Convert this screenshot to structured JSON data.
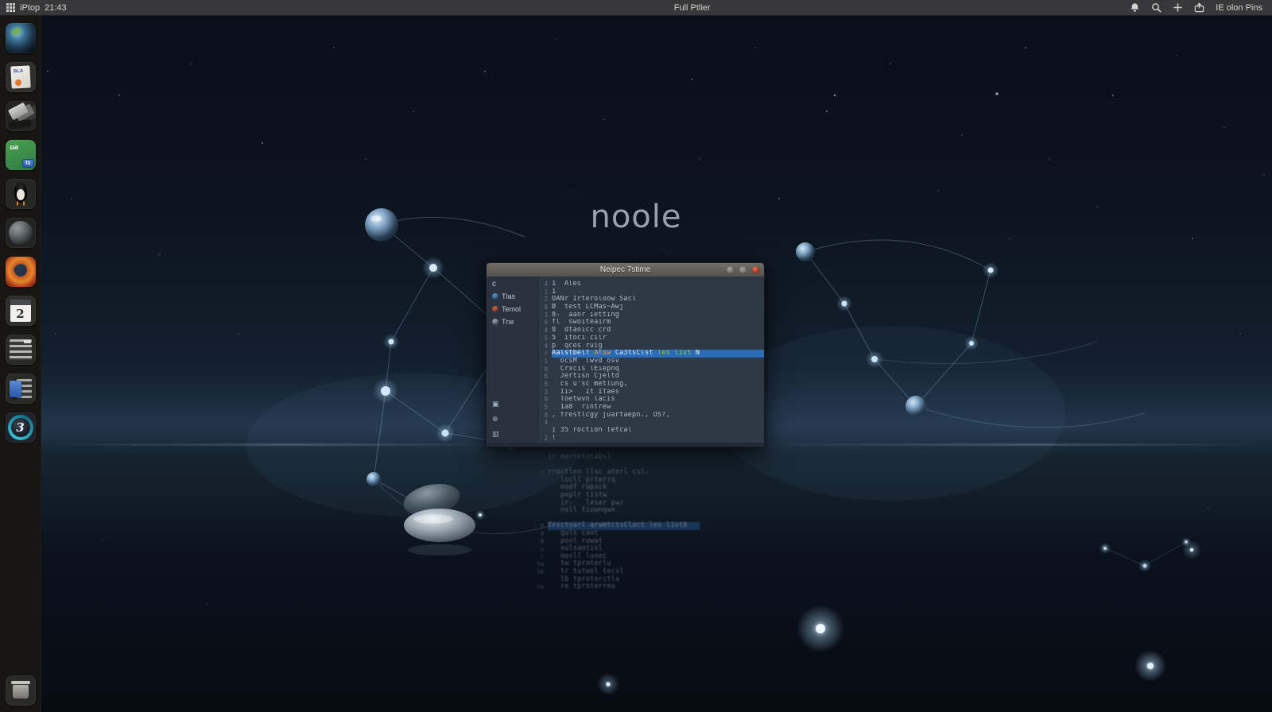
{
  "topbar": {
    "left_app": "iPtop",
    "left_time": "21:43",
    "center": "Full Ptlier",
    "right_label": "IE olon Pins",
    "right_icons": [
      "bell-icon",
      "search-icon",
      "plus-icon",
      "share-icon"
    ]
  },
  "dock": {
    "items": [
      {
        "name": "web-browser",
        "type": "globe"
      },
      {
        "name": "document-app",
        "type": "doc",
        "glyph": "BLA"
      },
      {
        "name": "files-app",
        "type": "cards"
      },
      {
        "name": "dev-tool",
        "type": "green-badge",
        "glyph": "ua",
        "sub": "ts"
      },
      {
        "name": "linux-tux",
        "type": "penguin"
      },
      {
        "name": "sphere-app",
        "type": "dark-sphere"
      },
      {
        "name": "firefox-browser",
        "type": "fox"
      },
      {
        "name": "calendar-app",
        "type": "calendar",
        "glyph": "2"
      },
      {
        "name": "text-editor",
        "type": "lines"
      },
      {
        "name": "word-processor",
        "type": "blue-doc"
      },
      {
        "name": "clock-app",
        "type": "teal-circle",
        "glyph": "3"
      }
    ],
    "trash": {
      "name": "trash",
      "type": "trash"
    }
  },
  "desktop": {
    "watermark": "noole"
  },
  "window": {
    "title": "Neipec 7stime",
    "controls": [
      "minimize",
      "maximize",
      "close"
    ],
    "sidebar": {
      "back": "c",
      "items": [
        {
          "label": "Tlas",
          "icon": "sphere-blue-icon",
          "color": "#4a87c6"
        },
        {
          "label": "Temol",
          "icon": "flame-orange-icon",
          "color": "#c05838"
        },
        {
          "label": "Tne",
          "icon": "doc-gray-icon",
          "color": "#8a939e"
        }
      ],
      "footer_icons": [
        {
          "name": "frame-icon",
          "glyph": "▣"
        },
        {
          "name": "globe-icon",
          "glyph": "⊕"
        },
        {
          "name": "columns-icon",
          "glyph": "▥"
        }
      ]
    },
    "editor": {
      "accent_highlight": "#2b6cb8",
      "lines": [
        {
          "num": "4",
          "text": "1  Ales"
        },
        {
          "num": "1",
          "text": "1"
        },
        {
          "num": "2",
          "text": "OANr Irteroloow Sacl"
        },
        {
          "num": "8",
          "text": "Ø  test LCMas~Awj"
        },
        {
          "num": "3",
          "text": "8-  aanr ietting"
        },
        {
          "num": "6",
          "text": "fl  swoiteairm"
        },
        {
          "num": "4",
          "text": "8  dtaoicc crd"
        },
        {
          "num": "5",
          "text": "5  itoci cilr"
        },
        {
          "num": "4",
          "text": "p  qces ruig"
        },
        {
          "num": "r",
          "highlight": true,
          "segments": [
            {
              "text": "AalstbelT ",
              "color": "#e9eef3"
            },
            {
              "text": "Atsw ",
              "color": "#e8a33d"
            },
            {
              "text": "Ca3tsClst ",
              "color": "#d9e5ef"
            },
            {
              "text": "les l1vt ",
              "color": "#8ec75a"
            },
            {
              "text": "N",
              "color": "#eaf0f5"
            }
          ]
        },
        {
          "num": "1",
          "text": "  ocsM  lwvd osv"
        },
        {
          "num": "0",
          "text": "  Crxcis lEiepnq"
        },
        {
          "num": "8",
          "text": "  Jertisn Cjeltd"
        },
        {
          "num": "8",
          "text": "  cs u'sc metlung,"
        },
        {
          "num": "3",
          "text": "  Ii>   It ITaes"
        },
        {
          "num": "9",
          "text": "  Toetwvn lacis"
        },
        {
          "num": "5",
          "text": "  1a8  rintrew"
        },
        {
          "num": "0",
          "text": ", frestlcgy juartaepn., OS?,"
        },
        {
          "num": "4",
          "text": ""
        },
        {
          "num": "",
          "text": "] 35 roction letcal"
        },
        {
          "num": "2",
          "text": "!"
        }
      ]
    }
  },
  "reflection": {
    "lines": [
      {
        "num": "",
        "text": "ir mertetotaUsl"
      },
      {
        "num": "",
        "text": ""
      },
      {
        "num": "r",
        "text": "rroctlen llsc aterl cul."
      },
      {
        "num": "",
        "text": "   locll prterrq"
      },
      {
        "num": "",
        "text": "   oodf rupsck"
      },
      {
        "num": "",
        "text": "   peplr tistw"
      },
      {
        "num": "",
        "text": "   ir-   leser pw/"
      },
      {
        "num": "",
        "text": "   noll tiowngwn"
      },
      {
        "num": "",
        "text": ""
      },
      {
        "num": "d",
        "text": "frsctsarl arwmtctsCloct les l1vt8",
        "highlight": true
      },
      {
        "num": "4",
        "text": "   guls cant"
      },
      {
        "num": "0",
        "text": "   ponl ruwat"
      },
      {
        "num": "u",
        "text": "   xulsaotisl"
      },
      {
        "num": "r",
        "text": "   mosll lunec"
      },
      {
        "num": "tw",
        "text": "   tw tproterlu"
      },
      {
        "num": "lb",
        "text": "   tr tutwol tecsl"
      },
      {
        "num": "",
        "text": "   lb tproterctlu"
      },
      {
        "num": "re",
        "text": "   re tproterreu"
      }
    ]
  }
}
